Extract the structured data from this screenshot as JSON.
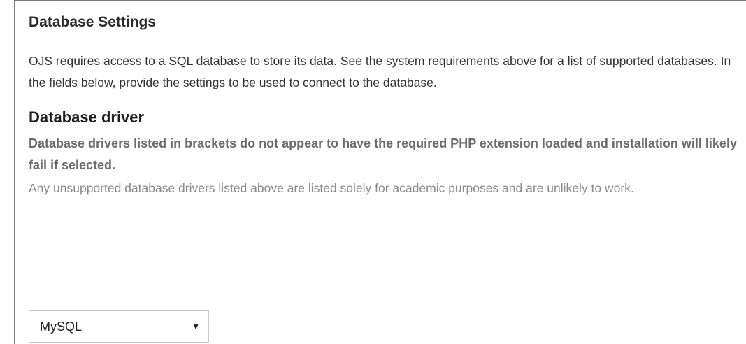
{
  "section": {
    "title": "Database Settings",
    "intro": "OJS requires access to a SQL database to store its data. See the system requirements above for a list of supported databases. In the fields below, provide the settings to be used to connect to the database."
  },
  "driver_field": {
    "label": "Database driver",
    "warning": "Database drivers listed in brackets do not appear to have the required PHP extension loaded and installation will likely fail if selected.",
    "note": "Any unsupported database drivers listed above are listed solely for academic purposes and are unlikely to work.",
    "selected_value": "MySQL",
    "dropdown_icon": "▼"
  }
}
